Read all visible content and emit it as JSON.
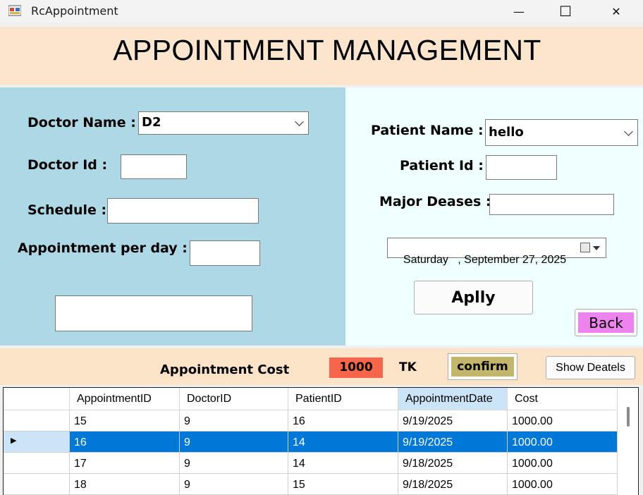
{
  "window": {
    "title": "RcAppointment",
    "minimize": "—",
    "maximize": "☐",
    "close": "✕"
  },
  "header": {
    "title": "APPOINTMENT MANAGEMENT"
  },
  "doctor": {
    "name_label": "Doctor Name :",
    "name_value": "D2",
    "id_label": "Doctor Id :",
    "id_value": "",
    "schedule_label": "Schedule :",
    "schedule_value": "",
    "appt_per_day_label": "Appointment per day :",
    "appt_per_day_value": "",
    "extra_field_value": ""
  },
  "patient": {
    "name_label": "Patient Name :",
    "name_value": "hello",
    "id_label": "Patient Id :",
    "id_value": "",
    "disease_label": "Major Deases :",
    "disease_value": "",
    "date_value": "Saturday   , September 27, 2025",
    "apply_label": "Aplly",
    "back_label": "Back"
  },
  "cost": {
    "label": "Appointment Cost",
    "value": "1000",
    "currency": "TK",
    "confirm_label": "confirm",
    "show_details_label": "Show Deatels"
  },
  "grid": {
    "columns": [
      "AppointmentID",
      "DoctorID",
      "PatientID",
      "AppointmentDate",
      "Cost"
    ],
    "rows": [
      [
        "15",
        "9",
        "16",
        "9/19/2025",
        "1000.00"
      ],
      [
        "16",
        "9",
        "14",
        "9/19/2025",
        "1000.00"
      ],
      [
        "17",
        "9",
        "14",
        "9/18/2025",
        "1000.00"
      ],
      [
        "18",
        "9",
        "15",
        "9/18/2025",
        "1000.00"
      ]
    ],
    "selected_row": 1,
    "current_row_marker": "▶"
  },
  "colors": {
    "header_bg": "#fbe6cd",
    "left_panel": "#add8e6",
    "right_panel": "#f0ffff",
    "cost_value_bg": "#f7654a",
    "confirm_bg": "#c2b66a",
    "back_bg": "#ee82ee",
    "selection": "#0078d7",
    "sorted_header": "#cce4f7"
  }
}
